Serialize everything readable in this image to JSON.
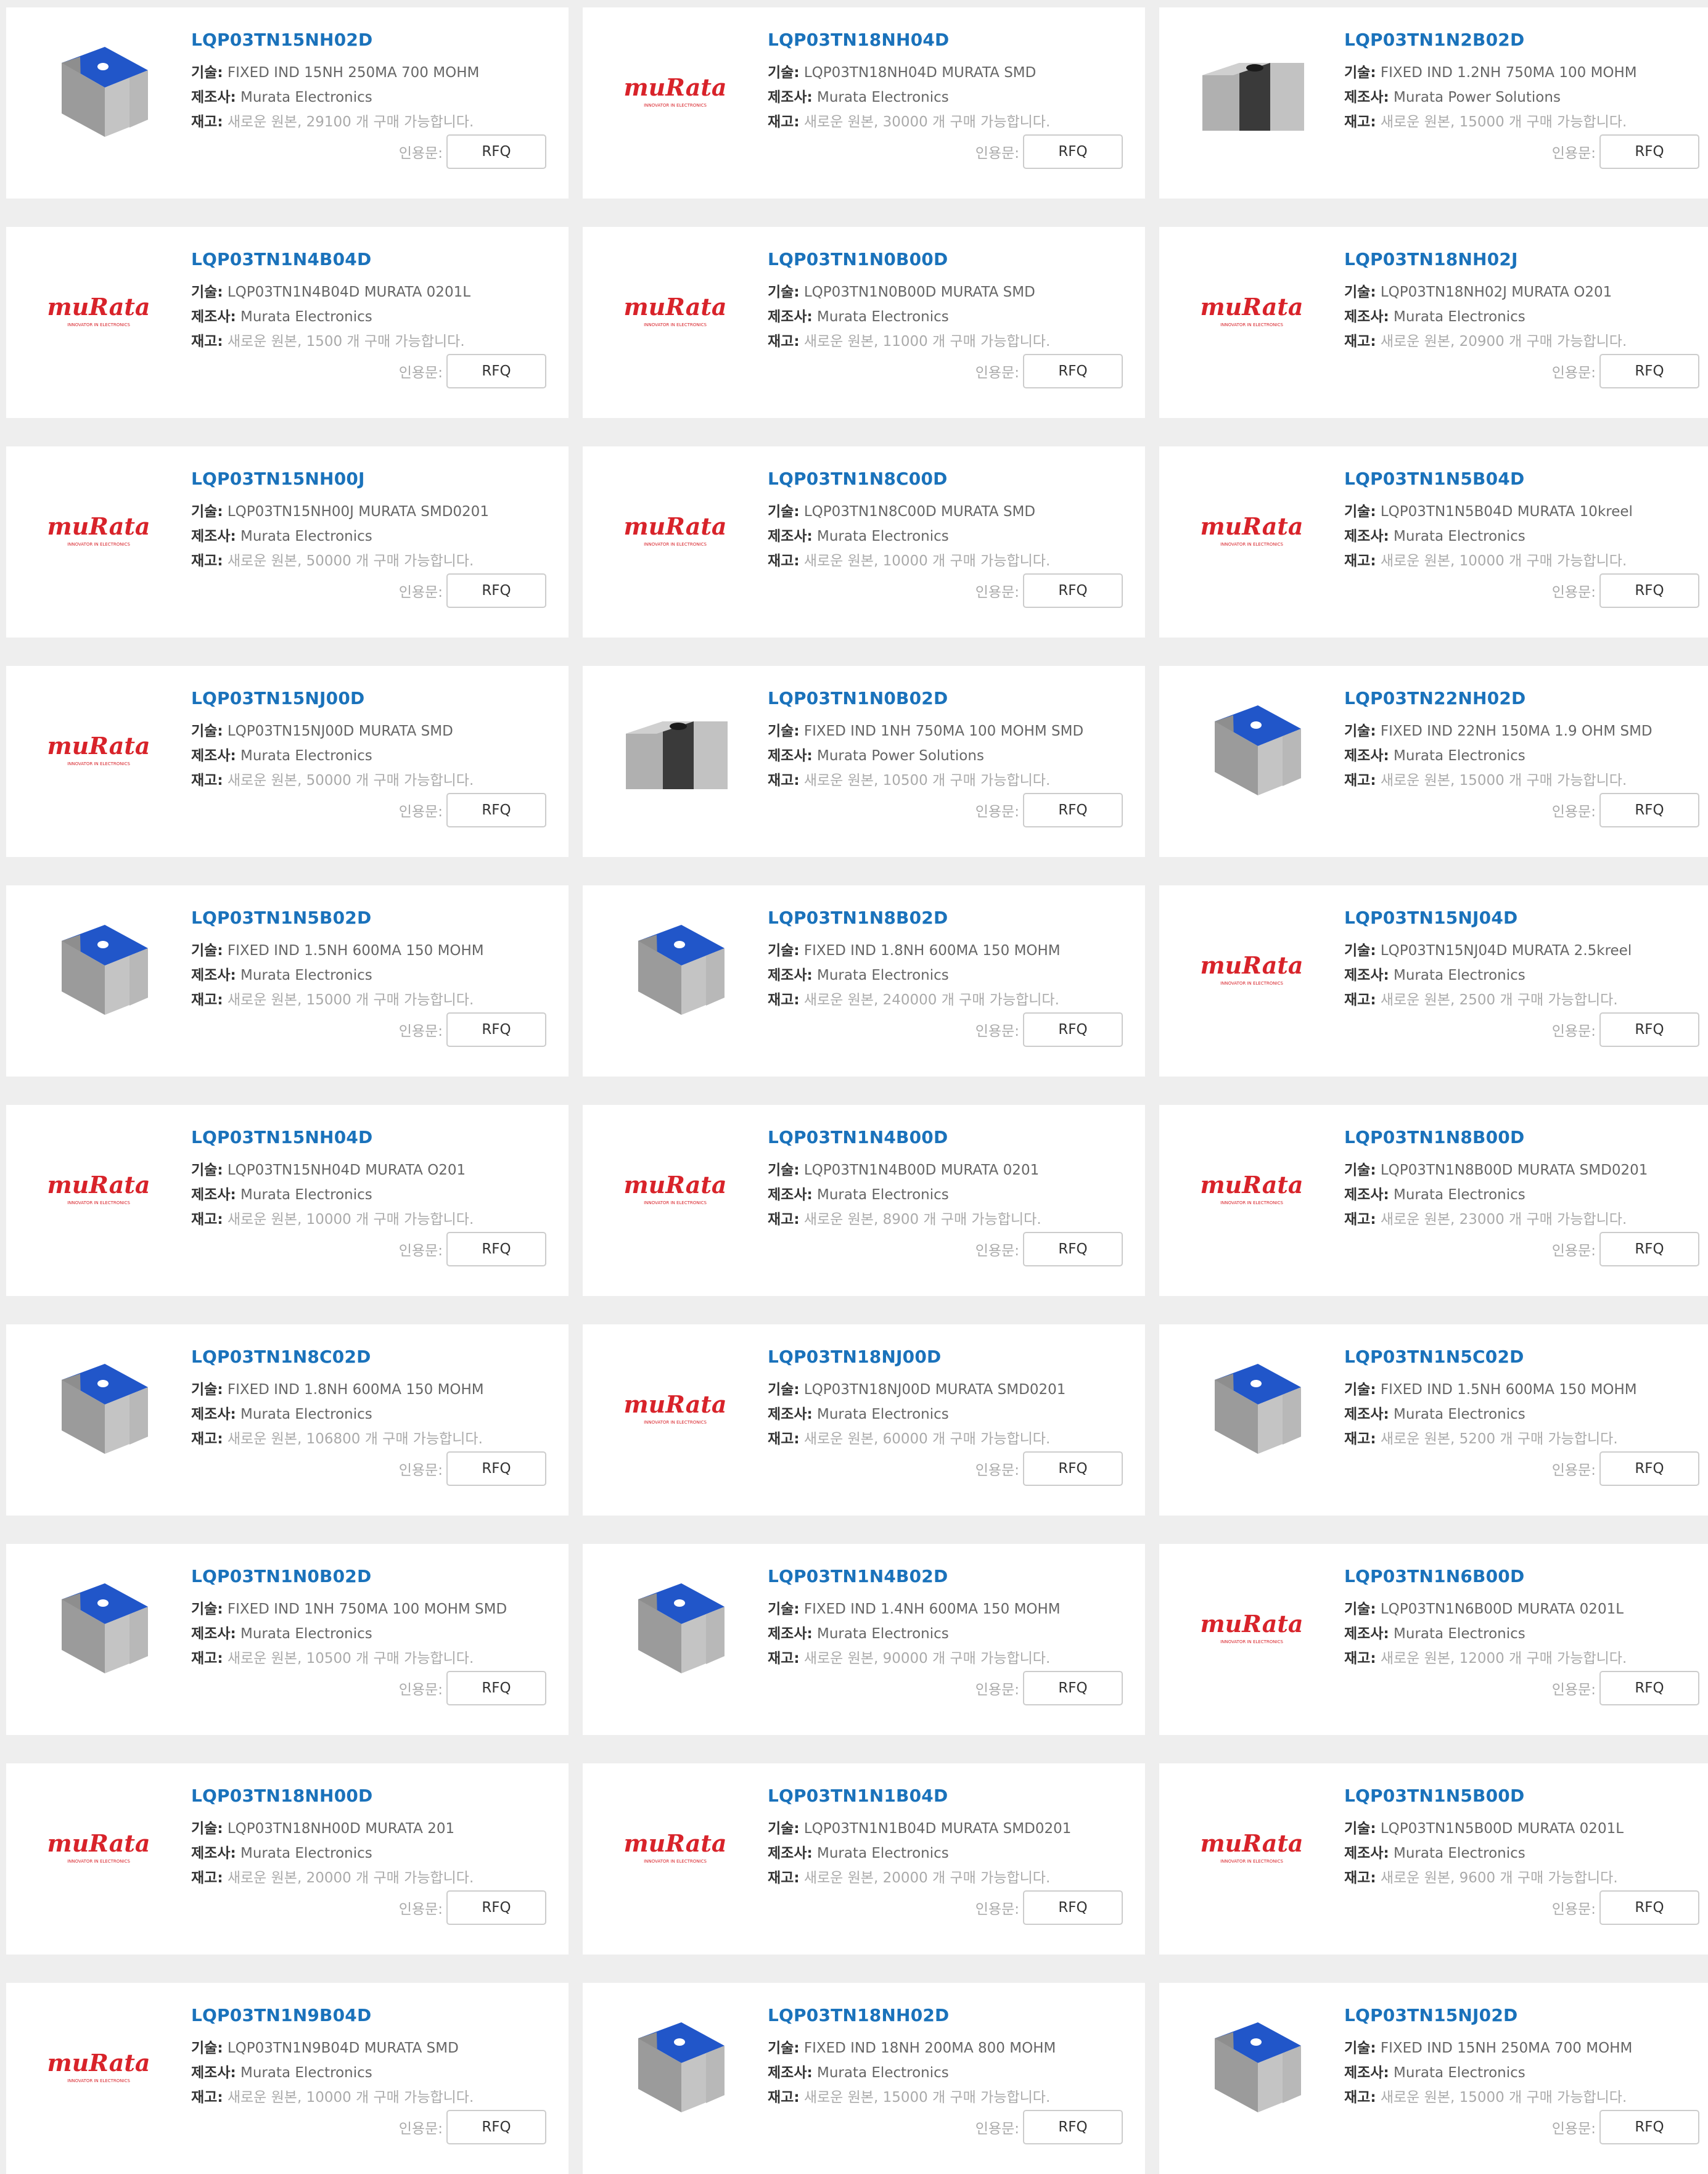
{
  "labels": {
    "tech": "기술:",
    "mfr": "제조사:",
    "stock": "재고:",
    "quote": "인용문:",
    "rfq": "RFQ"
  },
  "logo": {
    "text": "muRata",
    "tagline": "INNOVATOR IN ELECTRONICS",
    "color": "#d8232a"
  },
  "colors": {
    "partnum": "#1a72bb",
    "chip_body": "#a9a9a9",
    "chip_blue": "#2156c9",
    "chip_dark": "#3a3a3a"
  },
  "products": [
    {
      "part": "LQP03TN15NH02D",
      "tech": "FIXED IND 15NH 250MA 700 MOHM",
      "mfr": "Murata Electronics",
      "stock": "새로운 원본, 29100 개 구매 가능합니다.",
      "image": "blue-chip"
    },
    {
      "part": "LQP03TN18NH04D",
      "tech": "LQP03TN18NH04D MURATA SMD",
      "mfr": "Murata Electronics",
      "stock": "새로운 원본, 30000 개 구매 가능합니다.",
      "image": "murata-logo"
    },
    {
      "part": "LQP03TN1N2B02D",
      "tech": "FIXED IND 1.2NH 750MA 100 MOHM",
      "mfr": "Murata Power Solutions",
      "stock": "새로운 원본, 15000 개 구매 가능합니다.",
      "image": "dark-chip"
    },
    {
      "part": "LQP03TN1N4B04D",
      "tech": "LQP03TN1N4B04D MURATA 0201L",
      "mfr": "Murata Electronics",
      "stock": "새로운 원본, 1500 개 구매 가능합니다.",
      "image": "murata-logo"
    },
    {
      "part": "LQP03TN1N0B00D",
      "tech": "LQP03TN1N0B00D MURATA SMD",
      "mfr": "Murata Electronics",
      "stock": "새로운 원본, 11000 개 구매 가능합니다.",
      "image": "murata-logo"
    },
    {
      "part": "LQP03TN18NH02J",
      "tech": "LQP03TN18NH02J MURATA O201",
      "mfr": "Murata Electronics",
      "stock": "새로운 원본, 20900 개 구매 가능합니다.",
      "image": "murata-logo"
    },
    {
      "part": "LQP03TN15NH00J",
      "tech": "LQP03TN15NH00J MURATA SMD0201",
      "mfr": "Murata Electronics",
      "stock": "새로운 원본, 50000 개 구매 가능합니다.",
      "image": "murata-logo"
    },
    {
      "part": "LQP03TN1N8C00D",
      "tech": "LQP03TN1N8C00D MURATA SMD",
      "mfr": "Murata Electronics",
      "stock": "새로운 원본, 10000 개 구매 가능합니다.",
      "image": "murata-logo"
    },
    {
      "part": "LQP03TN1N5B04D",
      "tech": "LQP03TN1N5B04D MURATA 10kreel",
      "mfr": "Murata Electronics",
      "stock": "새로운 원본, 10000 개 구매 가능합니다.",
      "image": "murata-logo"
    },
    {
      "part": "LQP03TN15NJ00D",
      "tech": "LQP03TN15NJ00D MURATA SMD",
      "mfr": "Murata Electronics",
      "stock": "새로운 원본, 50000 개 구매 가능합니다.",
      "image": "murata-logo"
    },
    {
      "part": "LQP03TN1N0B02D",
      "tech": "FIXED IND 1NH 750MA 100 MOHM SMD",
      "mfr": "Murata Power Solutions",
      "stock": "새로운 원본, 10500 개 구매 가능합니다.",
      "image": "dark-chip"
    },
    {
      "part": "LQP03TN22NH02D",
      "tech": "FIXED IND 22NH 150MA 1.9 OHM SMD",
      "mfr": "Murata Electronics",
      "stock": "새로운 원본, 15000 개 구매 가능합니다.",
      "image": "blue-chip"
    },
    {
      "part": "LQP03TN1N5B02D",
      "tech": "FIXED IND 1.5NH 600MA 150 MOHM",
      "mfr": "Murata Electronics",
      "stock": "새로운 원본, 15000 개 구매 가능합니다.",
      "image": "blue-chip"
    },
    {
      "part": "LQP03TN1N8B02D",
      "tech": "FIXED IND 1.8NH 600MA 150 MOHM",
      "mfr": "Murata Electronics",
      "stock": "새로운 원본, 240000 개 구매 가능합니다.",
      "image": "blue-chip"
    },
    {
      "part": "LQP03TN15NJ04D",
      "tech": "LQP03TN15NJ04D MURATA 2.5kreel",
      "mfr": "Murata Electronics",
      "stock": "새로운 원본, 2500 개 구매 가능합니다.",
      "image": "murata-logo"
    },
    {
      "part": "LQP03TN15NH04D",
      "tech": "LQP03TN15NH04D MURATA O201",
      "mfr": "Murata Electronics",
      "stock": "새로운 원본, 10000 개 구매 가능합니다.",
      "image": "murata-logo"
    },
    {
      "part": "LQP03TN1N4B00D",
      "tech": "LQP03TN1N4B00D MURATA 0201",
      "mfr": "Murata Electronics",
      "stock": "새로운 원본, 8900 개 구매 가능합니다.",
      "image": "murata-logo"
    },
    {
      "part": "LQP03TN1N8B00D",
      "tech": "LQP03TN1N8B00D MURATA SMD0201",
      "mfr": "Murata Electronics",
      "stock": "새로운 원본, 23000 개 구매 가능합니다.",
      "image": "murata-logo"
    },
    {
      "part": "LQP03TN1N8C02D",
      "tech": "FIXED IND 1.8NH 600MA 150 MOHM",
      "mfr": "Murata Electronics",
      "stock": "새로운 원본, 106800 개 구매 가능합니다.",
      "image": "blue-chip"
    },
    {
      "part": "LQP03TN18NJ00D",
      "tech": "LQP03TN18NJ00D MURATA SMD0201",
      "mfr": "Murata Electronics",
      "stock": "새로운 원본, 60000 개 구매 가능합니다.",
      "image": "murata-logo"
    },
    {
      "part": "LQP03TN1N5C02D",
      "tech": "FIXED IND 1.5NH 600MA 150 MOHM",
      "mfr": "Murata Electronics",
      "stock": "새로운 원본, 5200 개 구매 가능합니다.",
      "image": "blue-chip"
    },
    {
      "part": "LQP03TN1N0B02D",
      "tech": "FIXED IND 1NH 750MA 100 MOHM SMD",
      "mfr": "Murata Electronics",
      "stock": "새로운 원본, 10500 개 구매 가능합니다.",
      "image": "blue-chip"
    },
    {
      "part": "LQP03TN1N4B02D",
      "tech": "FIXED IND 1.4NH 600MA 150 MOHM",
      "mfr": "Murata Electronics",
      "stock": "새로운 원본, 90000 개 구매 가능합니다.",
      "image": "blue-chip"
    },
    {
      "part": "LQP03TN1N6B00D",
      "tech": "LQP03TN1N6B00D MURATA 0201L",
      "mfr": "Murata Electronics",
      "stock": "새로운 원본, 12000 개 구매 가능합니다.",
      "image": "murata-logo"
    },
    {
      "part": "LQP03TN18NH00D",
      "tech": "LQP03TN18NH00D MURATA 201",
      "mfr": "Murata Electronics",
      "stock": "새로운 원본, 20000 개 구매 가능합니다.",
      "image": "murata-logo"
    },
    {
      "part": "LQP03TN1N1B04D",
      "tech": "LQP03TN1N1B04D MURATA SMD0201",
      "mfr": "Murata Electronics",
      "stock": "새로운 원본, 20000 개 구매 가능합니다.",
      "image": "murata-logo"
    },
    {
      "part": "LQP03TN1N5B00D",
      "tech": "LQP03TN1N5B00D MURATA 0201L",
      "mfr": "Murata Electronics",
      "stock": "새로운 원본, 9600 개 구매 가능합니다.",
      "image": "murata-logo"
    },
    {
      "part": "LQP03TN1N9B04D",
      "tech": "LQP03TN1N9B04D MURATA SMD",
      "mfr": "Murata Electronics",
      "stock": "새로운 원본, 10000 개 구매 가능합니다.",
      "image": "murata-logo"
    },
    {
      "part": "LQP03TN18NH02D",
      "tech": "FIXED IND 18NH 200MA 800 MOHM",
      "mfr": "Murata Electronics",
      "stock": "새로운 원본, 15000 개 구매 가능합니다.",
      "image": "blue-chip"
    },
    {
      "part": "LQP03TN15NJ02D",
      "tech": "FIXED IND 15NH 250MA 700 MOHM",
      "mfr": "Murata Electronics",
      "stock": "새로운 원본, 15000 개 구매 가능합니다.",
      "image": "blue-chip"
    }
  ]
}
